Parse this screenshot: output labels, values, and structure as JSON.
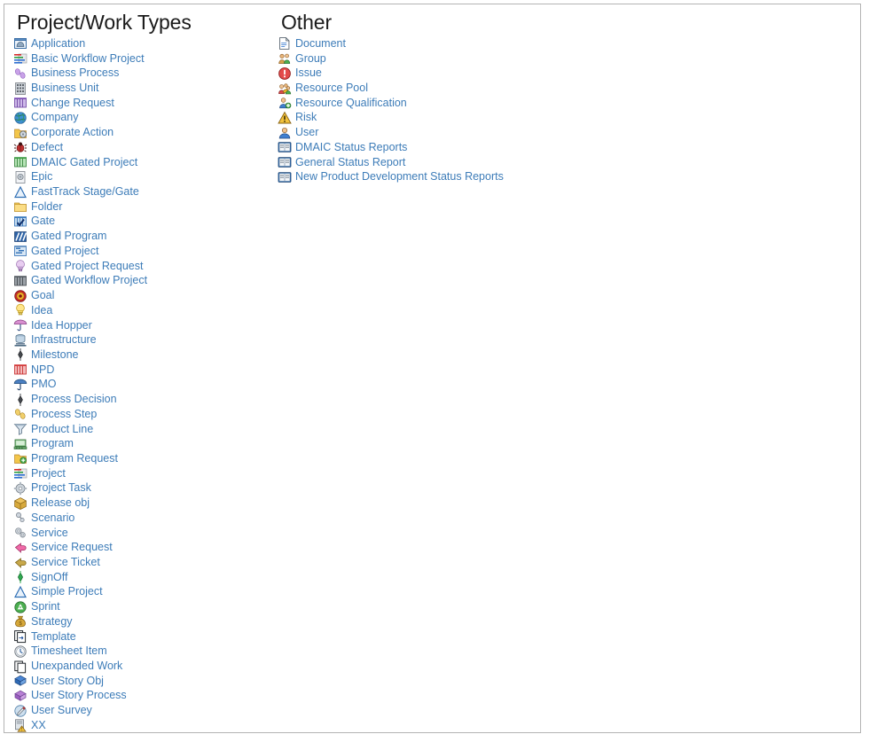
{
  "page": {
    "border_color": "#b3b3b3",
    "background": "#ffffff",
    "link_color": "#3d7cb8",
    "heading_color": "#1a1a1a"
  },
  "columns": [
    {
      "id": "project-work-types",
      "heading": "Project/Work Types",
      "items": [
        {
          "label": "Application",
          "icon": "application-icon"
        },
        {
          "label": "Basic Workflow Project",
          "icon": "basic-workflow-project-icon"
        },
        {
          "label": "Business Process",
          "icon": "business-process-icon"
        },
        {
          "label": "Business Unit",
          "icon": "business-unit-icon"
        },
        {
          "label": "Change Request",
          "icon": "change-request-icon"
        },
        {
          "label": "Company",
          "icon": "company-globe-icon"
        },
        {
          "label": "Corporate Action",
          "icon": "corporate-action-icon"
        },
        {
          "label": "Defect",
          "icon": "defect-bug-icon"
        },
        {
          "label": "DMAIC Gated Project",
          "icon": "dmaic-gated-project-icon"
        },
        {
          "label": "Epic",
          "icon": "epic-icon"
        },
        {
          "label": "FastTrack Stage/Gate",
          "icon": "fasttrack-stage-gate-icon"
        },
        {
          "label": "Folder",
          "icon": "folder-icon"
        },
        {
          "label": "Gate",
          "icon": "gate-icon"
        },
        {
          "label": "Gated Program",
          "icon": "gated-program-icon"
        },
        {
          "label": "Gated Project",
          "icon": "gated-project-icon"
        },
        {
          "label": "Gated Project Request",
          "icon": "gated-project-request-icon"
        },
        {
          "label": "Gated Workflow Project",
          "icon": "gated-workflow-project-icon"
        },
        {
          "label": "Goal",
          "icon": "goal-target-icon"
        },
        {
          "label": "Idea",
          "icon": "idea-bulb-icon"
        },
        {
          "label": "Idea Hopper",
          "icon": "idea-hopper-icon"
        },
        {
          "label": "Infrastructure",
          "icon": "infrastructure-icon"
        },
        {
          "label": "Milestone",
          "icon": "milestone-diamond-icon"
        },
        {
          "label": "NPD",
          "icon": "npd-icon"
        },
        {
          "label": "PMO",
          "icon": "pmo-icon"
        },
        {
          "label": "Process Decision",
          "icon": "process-decision-icon"
        },
        {
          "label": "Process Step",
          "icon": "process-step-footprints-icon"
        },
        {
          "label": "Product Line",
          "icon": "product-line-funnel-icon"
        },
        {
          "label": "Program",
          "icon": "program-icon"
        },
        {
          "label": "Program Request",
          "icon": "program-request-icon"
        },
        {
          "label": "Project",
          "icon": "project-icon"
        },
        {
          "label": "Project Task",
          "icon": "project-task-gear-icon"
        },
        {
          "label": "Release obj",
          "icon": "release-obj-package-icon"
        },
        {
          "label": "Scenario",
          "icon": "scenario-icon"
        },
        {
          "label": "Service",
          "icon": "service-gears-icon"
        },
        {
          "label": "Service Request",
          "icon": "service-request-icon"
        },
        {
          "label": "Service Ticket",
          "icon": "service-ticket-icon"
        },
        {
          "label": "SignOff",
          "icon": "signoff-diamond-icon"
        },
        {
          "label": "Simple Project",
          "icon": "simple-project-icon"
        },
        {
          "label": "Sprint",
          "icon": "sprint-recycle-icon"
        },
        {
          "label": "Strategy",
          "icon": "strategy-moneybag-icon"
        },
        {
          "label": "Template",
          "icon": "template-icon"
        },
        {
          "label": "Timesheet Item",
          "icon": "timesheet-item-clock-icon"
        },
        {
          "label": "Unexpanded Work",
          "icon": "unexpanded-work-icon"
        },
        {
          "label": "User Story Obj",
          "icon": "user-story-obj-icon"
        },
        {
          "label": "User Story Process",
          "icon": "user-story-process-icon"
        },
        {
          "label": "User Survey",
          "icon": "user-survey-icon"
        },
        {
          "label": "XX",
          "icon": "xx-warning-icon"
        }
      ]
    },
    {
      "id": "other",
      "heading": "Other",
      "items": [
        {
          "label": "Document",
          "icon": "document-icon"
        },
        {
          "label": "Group",
          "icon": "group-people-icon"
        },
        {
          "label": "Issue",
          "icon": "issue-alert-icon"
        },
        {
          "label": "Resource Pool",
          "icon": "resource-pool-icon"
        },
        {
          "label": "Resource Qualification",
          "icon": "resource-qualification-icon"
        },
        {
          "label": "Risk",
          "icon": "risk-warning-icon"
        },
        {
          "label": "User",
          "icon": "user-icon"
        },
        {
          "label": "DMAIC Status Reports",
          "icon": "report-book-icon"
        },
        {
          "label": "General Status Report",
          "icon": "report-book-icon"
        },
        {
          "label": "New Product Development Status Reports",
          "icon": "report-book-icon"
        }
      ]
    }
  ]
}
